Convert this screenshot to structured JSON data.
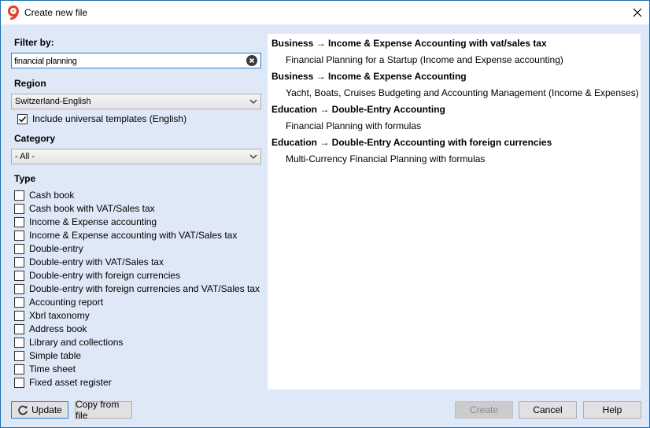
{
  "window": {
    "title": "Create new file",
    "app_icon": "banana-9-icon",
    "close_icon": "close-icon"
  },
  "filter": {
    "label": "Filter by:",
    "value": "financial planning",
    "clear_icon": "clear-icon"
  },
  "region": {
    "label": "Region",
    "selected": "Switzerland-English",
    "include_universal": {
      "label": "Include universal templates (English)",
      "checked": true
    }
  },
  "category": {
    "label": "Category",
    "selected": "- All -"
  },
  "type": {
    "label": "Type",
    "items": [
      {
        "label": "Cash book",
        "checked": false
      },
      {
        "label": "Cash book with VAT/Sales tax",
        "checked": false
      },
      {
        "label": "Income & Expense accounting",
        "checked": false
      },
      {
        "label": "Income & Expense accounting with VAT/Sales tax",
        "checked": false
      },
      {
        "label": "Double-entry",
        "checked": false
      },
      {
        "label": "Double-entry with VAT/Sales tax",
        "checked": false
      },
      {
        "label": "Double-entry with foreign currencies",
        "checked": false
      },
      {
        "label": "Double-entry with foreign currencies and VAT/Sales tax",
        "checked": false
      },
      {
        "label": "Accounting report",
        "checked": false
      },
      {
        "label": "Xbrl taxonomy",
        "checked": false
      },
      {
        "label": "Address book",
        "checked": false
      },
      {
        "label": "Library and collections",
        "checked": false
      },
      {
        "label": "Simple table",
        "checked": false
      },
      {
        "label": "Time sheet",
        "checked": false
      },
      {
        "label": "Fixed asset register",
        "checked": false
      }
    ]
  },
  "results": [
    {
      "group": "Business → Income & Expense Accounting with vat/sales tax",
      "template": "Financial Planning for a Startup (Income and Expense accounting)"
    },
    {
      "group": "Business → Income & Expense Accounting",
      "template": "Yacht, Boats, Cruises Budgeting and Accounting Management (Income & Expenses)"
    },
    {
      "group": "Education → Double-Entry Accounting",
      "template": "Financial Planning with formulas"
    },
    {
      "group": "Education → Double-Entry Accounting with foreign currencies",
      "template": "Multi-Currency Financial Planning with formulas"
    }
  ],
  "buttons": {
    "update": "Update",
    "update_icon": "refresh-icon",
    "copy_from_file": "Copy from file",
    "create": "Create",
    "cancel": "Cancel",
    "help": "Help"
  }
}
